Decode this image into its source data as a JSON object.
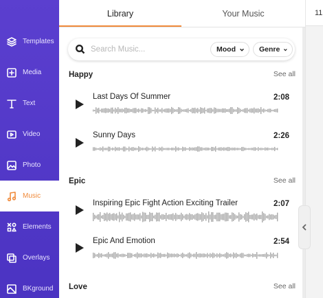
{
  "sidebar": {
    "items": [
      {
        "label": "Templates",
        "icon": "layers-icon"
      },
      {
        "label": "Media",
        "icon": "media-add-icon"
      },
      {
        "label": "Text",
        "icon": "text-icon"
      },
      {
        "label": "Video",
        "icon": "video-icon"
      },
      {
        "label": "Photo",
        "icon": "photo-icon"
      },
      {
        "label": "Music",
        "icon": "music-note-icon",
        "active": true
      },
      {
        "label": "Elements",
        "icon": "elements-icon"
      },
      {
        "label": "Overlays",
        "icon": "overlays-icon"
      },
      {
        "label": "BKground",
        "icon": "background-icon"
      }
    ],
    "accent": "#5b3fcf",
    "active_color": "#f08a3a"
  },
  "tabs": {
    "library": "Library",
    "your_music": "Your Music",
    "active": "Library"
  },
  "search": {
    "placeholder": "Search Music...",
    "value": "",
    "mood_label": "Mood",
    "genre_label": "Genre"
  },
  "categories": [
    {
      "title": "Happy",
      "see_all": "See all",
      "tracks": [
        {
          "name": "Last Days Of Summer",
          "duration": "2:08"
        },
        {
          "name": "Sunny Days",
          "duration": "2:26"
        }
      ]
    },
    {
      "title": "Epic",
      "see_all": "See all",
      "tracks": [
        {
          "name": "Inspiring Epic Fight Action Exciting Trailer",
          "duration": "2:07"
        },
        {
          "name": "Epic And Emotion",
          "duration": "2:54"
        }
      ]
    },
    {
      "title": "Love",
      "see_all": "See all",
      "tracks": []
    }
  ],
  "right_edge": {
    "top_number": "11"
  }
}
